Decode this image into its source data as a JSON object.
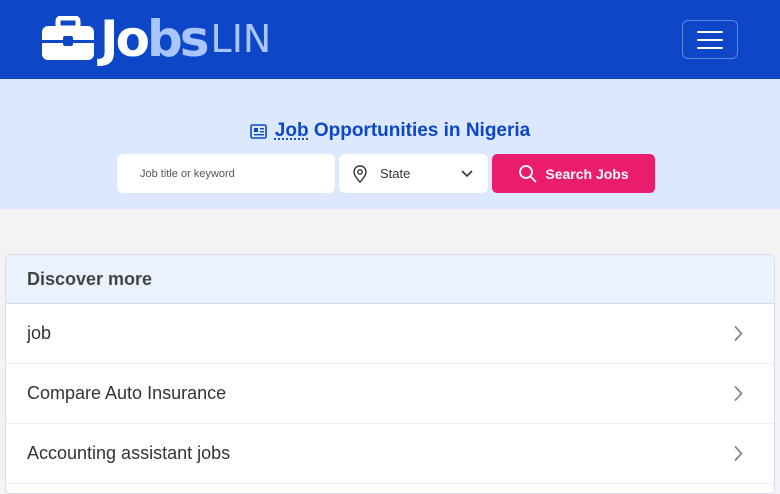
{
  "brand": {
    "name_a": "Jo",
    "name_b": "bs",
    "name_c": "LIN"
  },
  "nav": {
    "toggler_icon": "hamburger-icon"
  },
  "hero": {
    "icon": "newspaper-icon",
    "title_abbr": "Job",
    "title_rest": "Opportunities in Nigeria",
    "search": {
      "placeholder": "Job title or keyword",
      "value": "",
      "state_label": "State",
      "state_icon": "location-pin-icon",
      "button_label": "Search Jobs",
      "button_icon": "search-icon"
    }
  },
  "discover": {
    "heading": "Discover more",
    "items": [
      {
        "label": "job"
      },
      {
        "label": "Compare Auto Insurance"
      },
      {
        "label": "Accounting assistant jobs"
      }
    ]
  },
  "colors": {
    "navbar": "#0d47c7",
    "hero_bg": "#dbe8ff",
    "accent": "#ea1d6d",
    "title": "#0d47c7"
  }
}
